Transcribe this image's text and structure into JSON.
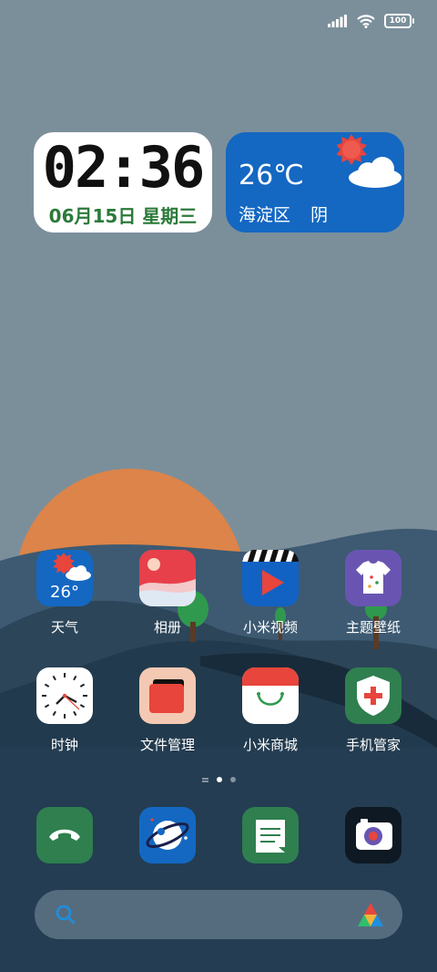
{
  "status_bar": {
    "battery_level": "100",
    "icons": [
      "signal-icon",
      "wifi-icon",
      "battery-icon"
    ]
  },
  "clock_widget": {
    "time": "02:36",
    "date": "06月15日 星期三"
  },
  "weather_widget": {
    "temperature": "26℃",
    "location": "海淀区",
    "condition": "阴",
    "icons": [
      "sun-icon",
      "cloud-icon"
    ]
  },
  "apps_row1": [
    {
      "label": "天气",
      "icon": "weather-icon",
      "temp": "26°"
    },
    {
      "label": "相册",
      "icon": "gallery-icon"
    },
    {
      "label": "小米视频",
      "icon": "video-icon"
    },
    {
      "label": "主题壁纸",
      "icon": "themes-icon"
    }
  ],
  "apps_row2": [
    {
      "label": "时钟",
      "icon": "clock-icon"
    },
    {
      "label": "文件管理",
      "icon": "file-manager-icon"
    },
    {
      "label": "小米商城",
      "icon": "mi-store-icon"
    },
    {
      "label": "手机管家",
      "icon": "security-icon"
    }
  ],
  "page_indicator": {
    "pages": 2,
    "current": 1
  },
  "dock": [
    {
      "icon": "phone-icon"
    },
    {
      "icon": "browser-icon"
    },
    {
      "icon": "messages-icon"
    },
    {
      "icon": "camera-icon"
    }
  ],
  "search": {
    "placeholder": "",
    "icons": [
      "search-icon",
      "assistant-icon"
    ]
  },
  "colors": {
    "clock_date": "#2c7a3a",
    "weather_bg": "#1468c2",
    "sun": "#e26f4a",
    "sky": "#7b8f9b"
  }
}
